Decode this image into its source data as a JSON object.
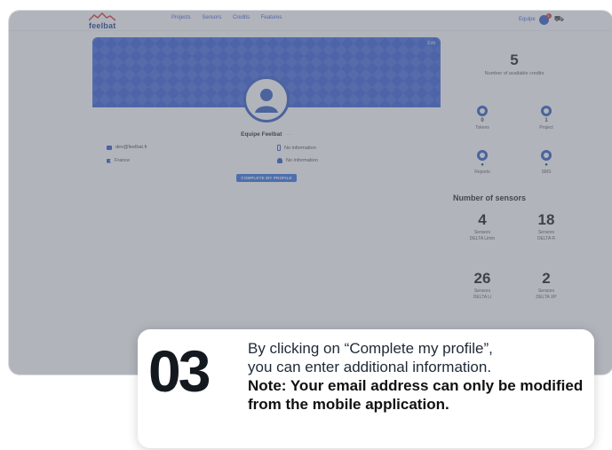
{
  "app": {
    "logo_text": "feelbat",
    "nav": [
      "Projects",
      "Sensors",
      "Credits",
      "Features"
    ],
    "user_name": "Equipe",
    "notif_count": "1"
  },
  "profile": {
    "banner_edit": "Edit",
    "name": "Equipe Feelbat",
    "name_more": "···",
    "email": "dev@feelbat.fr",
    "country": "France",
    "phone": "No information",
    "company": "No information",
    "complete_button": "COMPLETE MY PROFILE"
  },
  "stats": {
    "credits_value": "5",
    "credits_label": "Number of available credits",
    "mini": [
      {
        "value": "0",
        "label": "Tokens"
      },
      {
        "value": "1",
        "label": "Project"
      },
      {
        "value": "●",
        "label": "Reports"
      },
      {
        "value": "●",
        "label": "SMS"
      }
    ]
  },
  "sensors": {
    "title": "Number of sensors",
    "items": [
      {
        "value": "4",
        "line1": "Sensors",
        "line2": "DELTA Limin"
      },
      {
        "value": "18",
        "line1": "Sensors",
        "line2": "DELTA R"
      },
      {
        "value": "26",
        "line1": "Sensors",
        "line2": "DELTA Li"
      },
      {
        "value": "2",
        "line1": "Sensors",
        "line2": "DELTA XP"
      }
    ]
  },
  "callout": {
    "step": "03",
    "line1": "By clicking on “Complete my profile”,",
    "line2": "you can enter additional information.",
    "note": "Note: Your email address can only be modified from the mobile application."
  },
  "colors": {
    "primary": "#2b59c3",
    "banner": "#2f5bd8",
    "overlay": "#69707c"
  }
}
